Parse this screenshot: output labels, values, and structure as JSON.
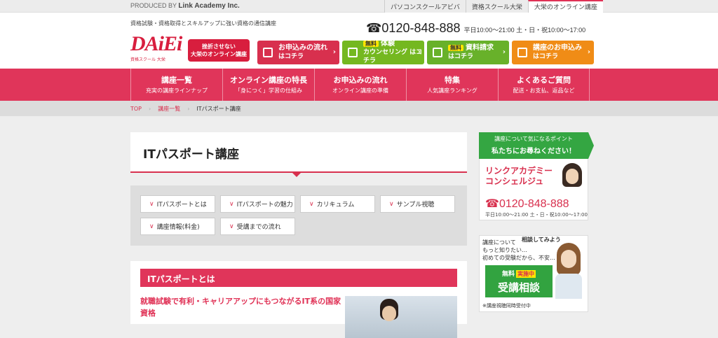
{
  "topbar": {
    "produced_by": "PRODUCED BY",
    "company": "Link Academy Inc.",
    "site_tabs": [
      "パソコンスクールアビバ",
      "資格スクール大栄",
      "大栄のオンライン講座"
    ]
  },
  "header": {
    "tagline": "資格試験・資格取得とスキルアップに強い資格の通信講座",
    "logo_text": "DAiEi",
    "logo_sub": "資格スクール 大栄",
    "badge_line1": "挫折させない",
    "badge_line2": "大栄のオンライン講座",
    "phone": "0120-848-888",
    "hours": "平日10:00～21:00 土・日・祝10:00～17:00"
  },
  "cta": [
    {
      "label": "お申込みの流れ",
      "sub": "はコチラ",
      "free": ""
    },
    {
      "label": "体験",
      "sub": "カウンセリング はコチラ",
      "free": "無料"
    },
    {
      "label": "資料請求",
      "sub": "はコチラ",
      "free": "無料"
    },
    {
      "label": "講座のお申込み",
      "sub": "はコチラ",
      "free": ""
    }
  ],
  "nav": [
    {
      "title": "講座一覧",
      "sub": "充実の講座ラインナップ"
    },
    {
      "title": "オンライン講座の特長",
      "sub": "「身につく」学習の仕組み"
    },
    {
      "title": "お申込みの流れ",
      "sub": "オンライン講座の準備"
    },
    {
      "title": "特集",
      "sub": "人気講座ランキング"
    },
    {
      "title": "よくあるご質問",
      "sub": "配送・お支払、返品など"
    }
  ],
  "breadcrumb": [
    "TOP",
    "講座一覧",
    "ITパスポート講座"
  ],
  "main": {
    "title": "ITパスポート講座",
    "jump_links": [
      "ITパスポートとは",
      "ITパスポートの魅力",
      "カリキュラム",
      "サンプル視聴",
      "講座情報(料金)",
      "受講までの流れ"
    ],
    "section_title": "ITパスポートとは",
    "section_lead": "就職試験で有利・キャリアアップにもつながるIT系の国家資格"
  },
  "side": {
    "top_line1": "講座について気になるポイント",
    "top_line2": "私たちにお尋ねください！",
    "concierge_line1": "リンクアカデミー",
    "concierge_line2": "コンシェルジュ",
    "tel": "0120-848-888",
    "hours": "平日10:00～21:00 土・日・祝10:00～17:00",
    "consult_q1a": "講座について",
    "consult_q1b": "もっと知りたい…",
    "consult_bubble": "相談してみよう",
    "consult_q2": "初めての受験だから、不安…",
    "consult_free": "無料",
    "consult_now": "実施中",
    "consult_big": "受講相談",
    "consult_note": "※講座視聴同時受付中"
  }
}
